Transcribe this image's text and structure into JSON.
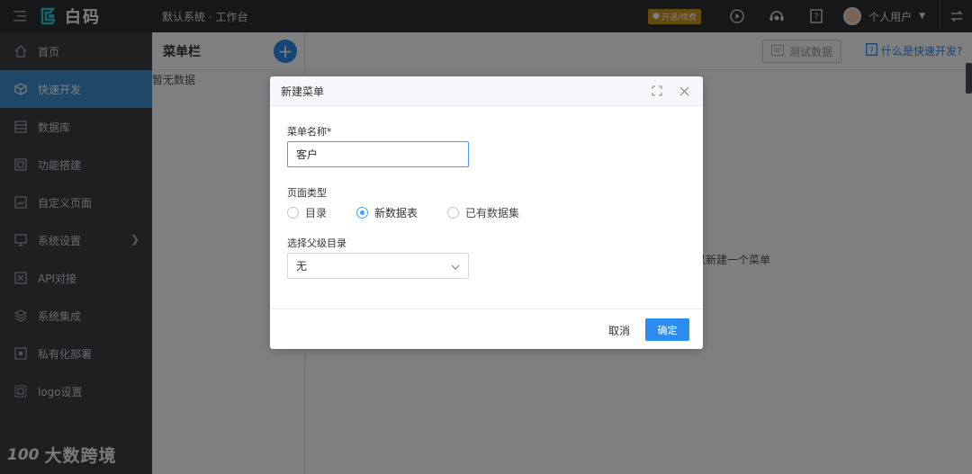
{
  "topbar": {
    "logo_text": "白码",
    "workspace_title": "默认系统 · 工作台",
    "upgrade_badge": "开通/续费",
    "user_name": "个人用户"
  },
  "sidebar": {
    "items": [
      {
        "label": "首页",
        "icon": "home-icon"
      },
      {
        "label": "快速开发",
        "icon": "cube-icon"
      },
      {
        "label": "数据库",
        "icon": "database-icon"
      },
      {
        "label": "功能搭建",
        "icon": "build-icon"
      },
      {
        "label": "自定义页面",
        "icon": "page-icon"
      },
      {
        "label": "系统设置",
        "icon": "monitor-icon"
      },
      {
        "label": "API对接",
        "icon": "api-icon"
      },
      {
        "label": "系统集成",
        "icon": "layers-icon"
      },
      {
        "label": "私有化部署",
        "icon": "deploy-icon"
      },
      {
        "label": "logo设置",
        "icon": "logo-settings-icon"
      }
    ],
    "active_index": 1
  },
  "menu_panel": {
    "title": "菜单栏",
    "empty_text": "暂无数据"
  },
  "main": {
    "test_data_label": "测试数据",
    "help_link": "什么是快速开发?",
    "hint_text": "以新建一个菜单"
  },
  "modal": {
    "title": "新建菜单",
    "name_label": "菜单名称*",
    "name_value": "客户",
    "page_type_label": "页面类型",
    "page_type_options": [
      "目录",
      "新数据表",
      "已有数据集"
    ],
    "page_type_selected": "新数据表",
    "parent_label": "选择父级目录",
    "parent_value": "无",
    "cancel_label": "取消",
    "confirm_label": "确定"
  },
  "watermark": {
    "logo": "100",
    "text": "大数跨境"
  },
  "colors": {
    "accent": "#2d8cf0",
    "sidebar_bg": "#3a3e43",
    "topbar_bg": "#2c2f33",
    "badge": "#c8951a"
  }
}
